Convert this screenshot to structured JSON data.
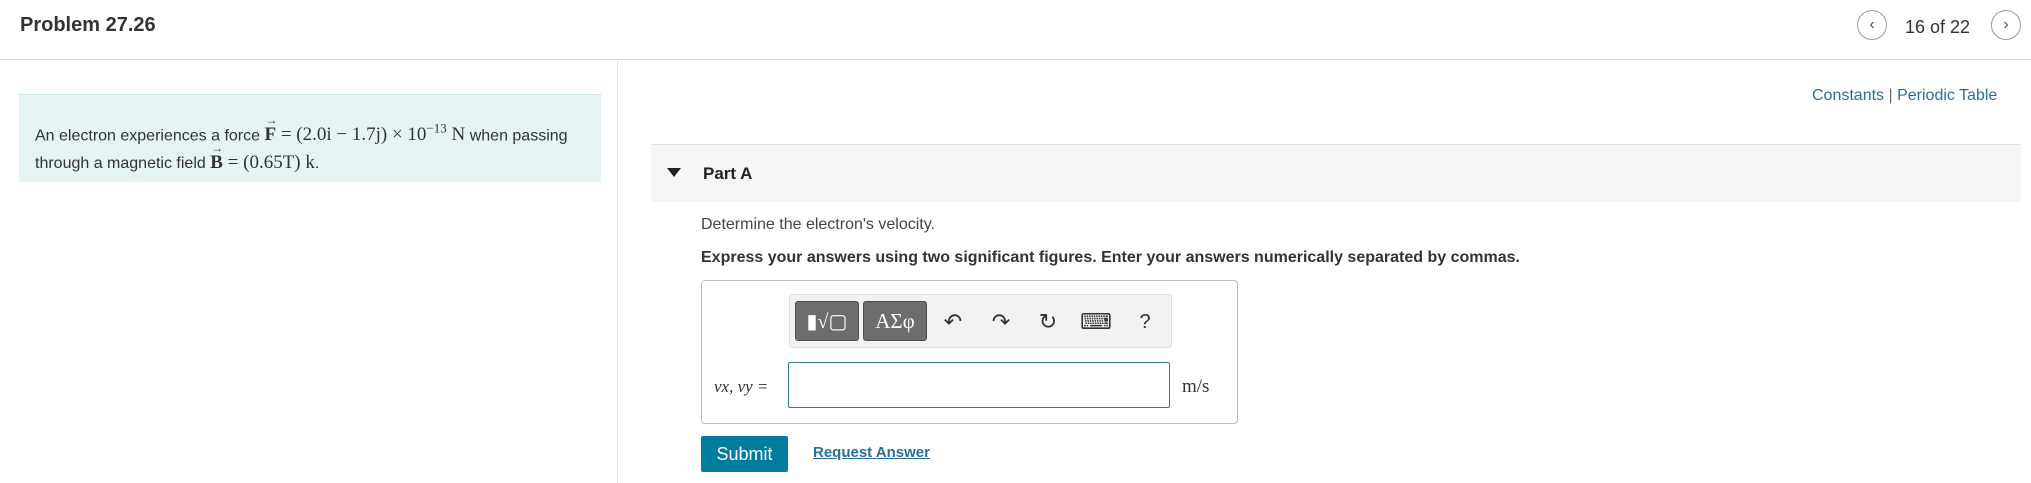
{
  "header": {
    "title": "Problem 27.26",
    "counter": "16 of 22",
    "prev_icon": "chevron-left-icon",
    "next_icon": "chevron-right-icon"
  },
  "problem": {
    "text_intro": "An electron experiences a force ",
    "force_symbol": "F",
    "force_expr": " = (2.0i − 1.7j) × 10",
    "force_exp": "−13",
    "force_unit": " N",
    "text_mid": " when passing through a magnetic field ",
    "field_symbol": "B",
    "field_expr": " = (0.65T) k",
    "text_end": "."
  },
  "resources": {
    "constants": "Constants",
    "separator": " | ",
    "periodic_table": "Periodic Table"
  },
  "part": {
    "label": "Part A",
    "question": "Determine the electron's velocity.",
    "instructions": "Express your answers using two significant figures. Enter your answers numerically separated by commas."
  },
  "answer": {
    "variable_label": "vx, vy =",
    "value": "",
    "units": "m/s"
  },
  "toolbar": {
    "template_label": "▮√▢",
    "greek_label": "ΑΣφ",
    "undo": "↶",
    "redo": "↷",
    "reset": "↻",
    "keyboard": "⌨",
    "help": "?"
  },
  "actions": {
    "submit": "Submit",
    "request": "Request Answer"
  },
  "colors": {
    "accent": "#007c9e",
    "link": "#2a6f97",
    "problem_bg": "#e6f4f4"
  }
}
